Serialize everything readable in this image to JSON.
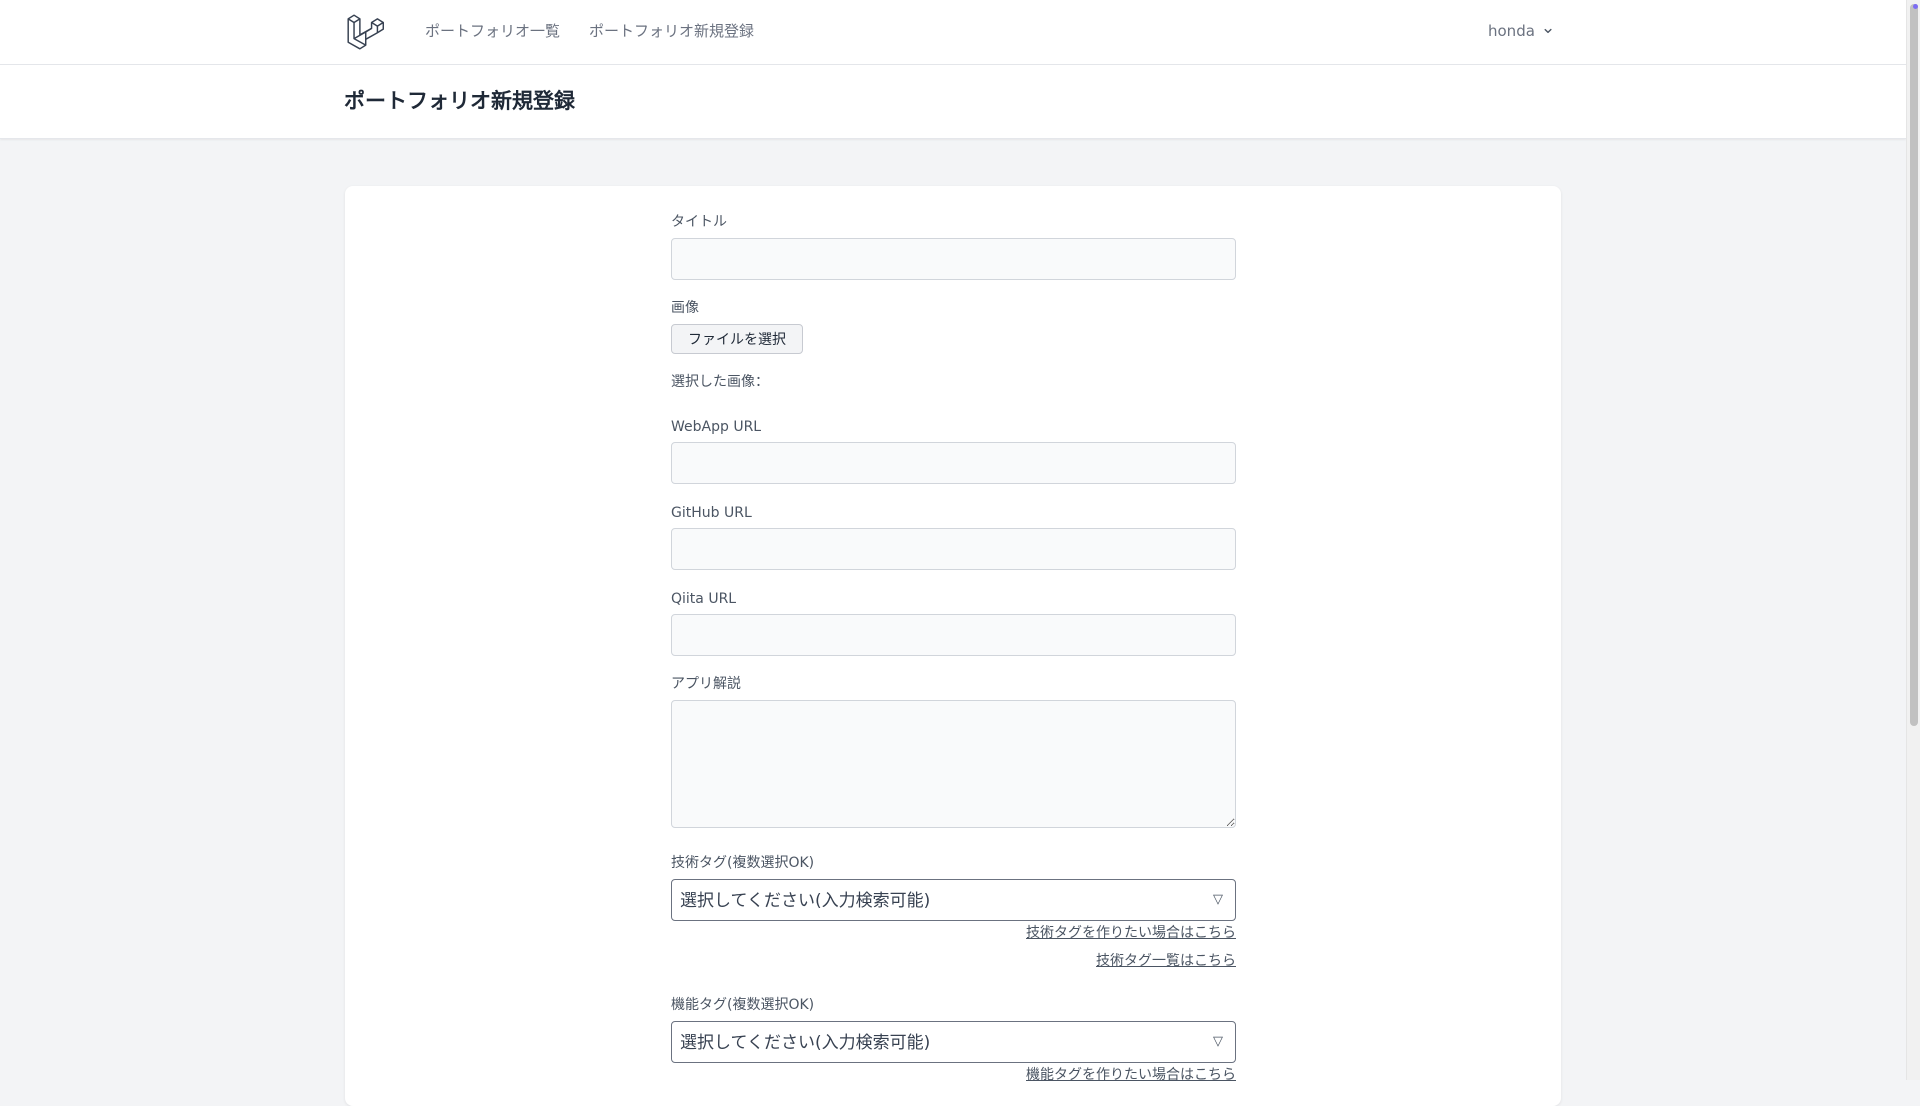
{
  "nav": {
    "links": [
      "ポートフォリオ一覧",
      "ポートフォリオ新規登録"
    ],
    "user_name": "honda"
  },
  "header": {
    "title": "ポートフォリオ新規登録"
  },
  "form": {
    "title_label": "タイトル",
    "image_label": "画像",
    "file_button_label": "ファイルを選択",
    "selected_image_label": "選択した画像：",
    "webapp_label": "WebApp URL",
    "github_label": "GitHub URL",
    "qiita_label": "Qiita URL",
    "description_label": "アプリ解説",
    "tech_tag_label": "技術タグ(複数選択OK)",
    "tech_tag_placeholder": "選択してください(入力検索可能)",
    "tech_tag_create_link": "技術タグを作りたい場合はこちら",
    "tech_tag_list_link": "技術タグ一覧はこちら",
    "feature_tag_label": "機能タグ(複数選択OK)",
    "feature_tag_placeholder": "選択してください(入力検索可能)",
    "feature_tag_create_link": "機能タグを作りたい場合はこちら",
    "select_arrow": "▽"
  }
}
